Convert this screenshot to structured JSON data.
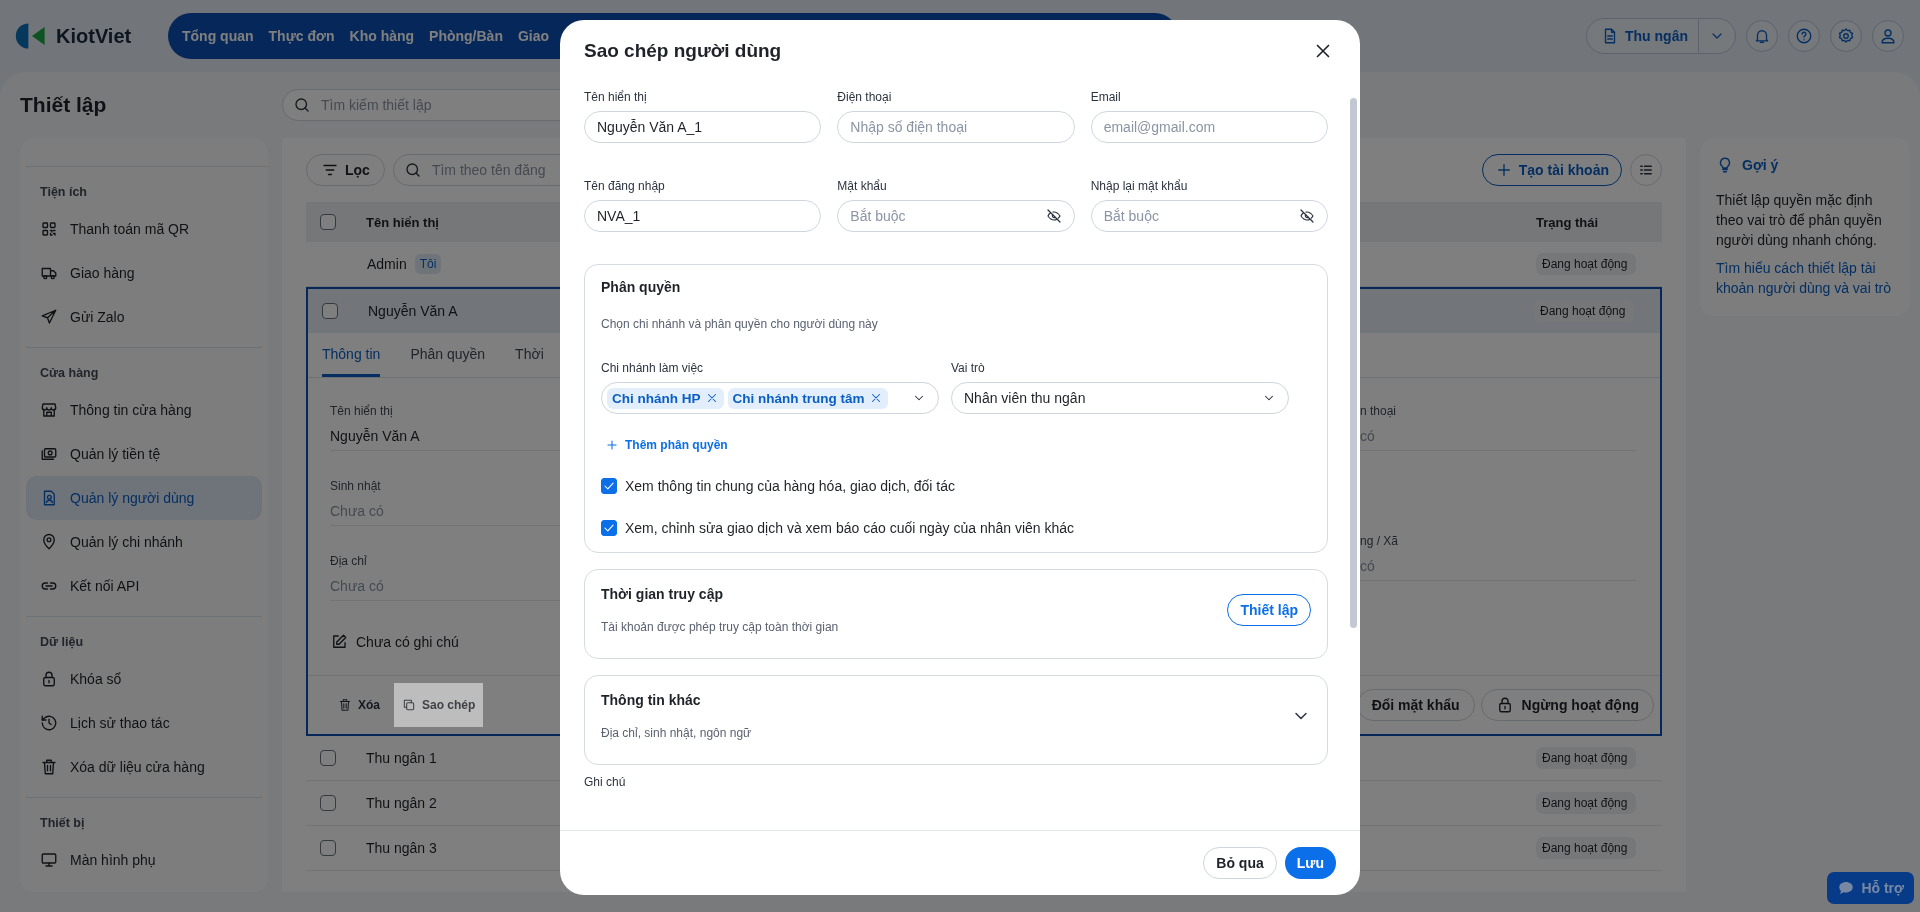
{
  "header": {
    "logo": "KiotViet",
    "nav": [
      {
        "label": "Tổng quan",
        "selected": false
      },
      {
        "label": "Thực đơn",
        "selected": false
      },
      {
        "label": "Kho hàng",
        "selected": false
      },
      {
        "label": "Phòng/Bàn",
        "selected": false
      },
      {
        "label": "Giao",
        "selected": false
      }
    ],
    "role_button": "Thu ngân"
  },
  "page": {
    "title": "Thiết lập",
    "search_placeholder": "Tìm kiếm thiết lập"
  },
  "sidebar": {
    "sections": [
      {
        "title": "Tiện ích",
        "items": [
          {
            "label": "Thanh toán mã QR",
            "selected": false
          },
          {
            "label": "Giao hàng",
            "selected": false
          },
          {
            "label": "Gửi Zalo",
            "selected": false
          }
        ]
      },
      {
        "title": "Cửa hàng",
        "items": [
          {
            "label": "Thông tin cửa hàng",
            "selected": false
          },
          {
            "label": "Quản lý tiền tệ",
            "selected": false
          },
          {
            "label": "Quản lý người dùng",
            "selected": true
          },
          {
            "label": "Quản lý chi nhánh",
            "selected": false
          },
          {
            "label": "Kết nối API",
            "selected": false
          }
        ]
      },
      {
        "title": "Dữ liệu",
        "items": [
          {
            "label": "Khóa sổ",
            "selected": false
          },
          {
            "label": "Lịch sử thao tác",
            "selected": false
          },
          {
            "label": "Xóa dữ liệu cửa hàng",
            "selected": false
          }
        ]
      },
      {
        "title": "Thiết bị",
        "items": [
          {
            "label": "Màn hình phụ",
            "selected": false
          }
        ]
      }
    ]
  },
  "toolbar": {
    "filter_button": "Lọc",
    "search_placeholder": "Tìm theo tên đăng",
    "create_button": "Tạo tài khoản"
  },
  "table": {
    "columns": [
      "Tên hiển thị",
      "Trạng thái"
    ],
    "all_checked": false,
    "rows": [
      {
        "name": "Admin",
        "badge": "Tôi",
        "status": "Đang hoạt động",
        "expanded": false
      },
      {
        "name": "Nguyễn Văn A",
        "checked": false,
        "status": "Đang hoạt động",
        "expanded": true,
        "detail": {
          "tabs": [
            {
              "label": "Thông tin",
              "selected": true
            },
            {
              "label": "Phân quyền",
              "selected": false
            },
            {
              "label": "Thời",
              "selected": false
            }
          ],
          "fields": [
            {
              "label": "Tên hiển thị",
              "value": "Nguyễn Văn A",
              "empty": false
            },
            {
              "label": "Sinh nhật",
              "value": "Chưa có",
              "empty": true
            },
            {
              "label": "Địa chỉ",
              "value": "Chưa có",
              "empty": true
            }
          ],
          "right_fields": [
            {
              "label": "n thoại",
              "value": "có"
            },
            {
              "label": "ng / Xã",
              "value": "có"
            }
          ],
          "note": "Chưa có ghi chú",
          "actions": [
            {
              "label": "Xóa",
              "selected": false
            },
            {
              "label": "Sao chép",
              "selected": true
            }
          ],
          "buttons": [
            "Đổi mặt khẩu",
            "Ngừng hoạt động"
          ]
        }
      },
      {
        "name": "Thu ngân 1",
        "checked": false,
        "status": "Đang hoạt động",
        "expanded": false
      },
      {
        "name": "Thu ngân 2",
        "checked": false,
        "status": "Đang hoạt động",
        "expanded": false
      },
      {
        "name": "Thu ngân 3",
        "checked": false,
        "status": "Đang hoạt động",
        "expanded": false
      }
    ]
  },
  "hint": {
    "title": "Gợi ý",
    "text": "Thiết lập quyền mặc định theo vai trò để phân quyền người dùng nhanh chóng.",
    "link": "Tìm hiểu cách thiết lập tài khoản người dùng và vai trò"
  },
  "support_button": "Hỗ trợ",
  "modal": {
    "title": "Sao chép người dùng",
    "fields": [
      {
        "label": "Tên hiển thị",
        "value": "Nguyễn Văn A_1",
        "kind": "text"
      },
      {
        "label": "Điện thoại",
        "placeholder": "Nhập số điện thoại",
        "kind": "text"
      },
      {
        "label": "Email",
        "placeholder": "email@gmail.com",
        "kind": "text"
      },
      {
        "label": "Tên đăng nhập",
        "value": "NVA_1",
        "kind": "text"
      },
      {
        "label": "Mật khẩu",
        "placeholder": "Bắt buộc",
        "kind": "password"
      },
      {
        "label": "Nhập lại mật khẩu",
        "placeholder": "Bắt buộc",
        "kind": "password"
      }
    ],
    "permissions": {
      "title": "Phân quyền",
      "subtitle": "Chọn chi nhánh và phân quyền cho người dùng này",
      "branch_label": "Chi nhánh làm việc",
      "branches": [
        "Chi nhánh HP",
        "Chi nhánh trung tâm"
      ],
      "role_label": "Vai trò",
      "role": "Nhân viên thu ngân",
      "add_link": "Thêm phân quyền",
      "options": [
        {
          "label": "Xem thông tin chung của hàng hóa, giao dịch, đối tác",
          "checked": true
        },
        {
          "label": "Xem, chỉnh sửa giao dịch và xem báo cáo cuối ngày của nhân viên khác",
          "checked": true
        }
      ]
    },
    "access": {
      "title": "Thời gian truy cập",
      "subtitle": "Tài khoản được phép truy cập toàn thời gian",
      "button": "Thiết lập"
    },
    "other": {
      "title": "Thông tin khác",
      "subtitle": "Địa chỉ, sinh nhật, ngôn ngữ",
      "expanded": false
    },
    "note_label": "Ghi chú",
    "cancel_button": "Bỏ qua",
    "save_button": "Lưu"
  }
}
